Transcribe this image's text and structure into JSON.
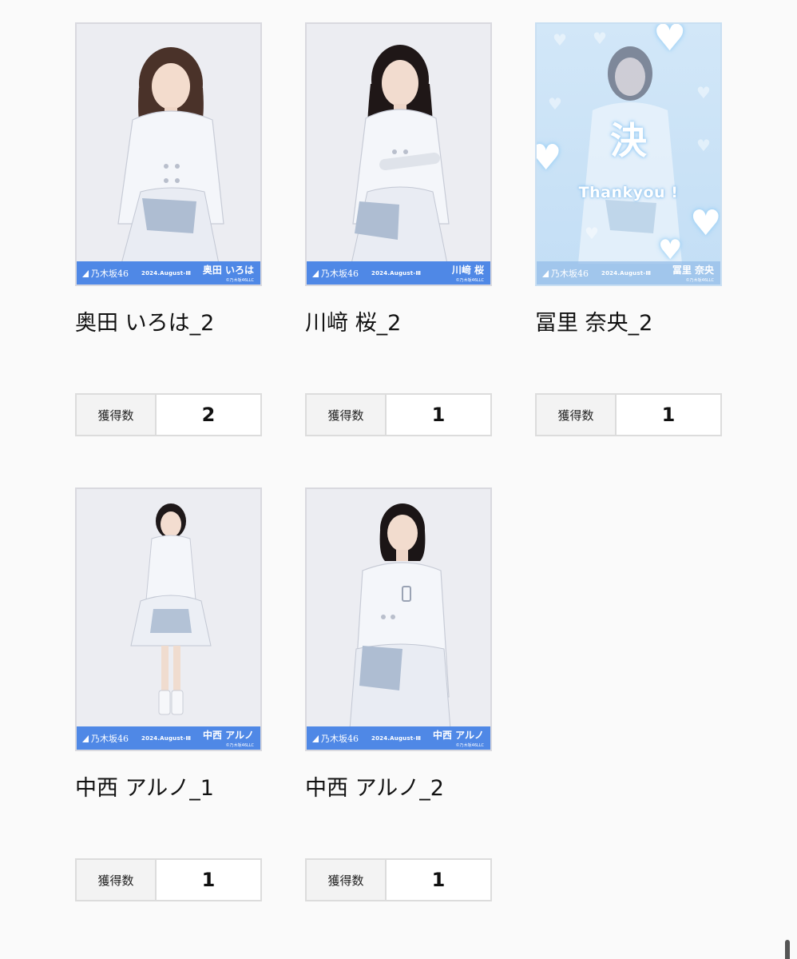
{
  "cards": [
    {
      "title": "奥田 いろは_2",
      "count_label": "獲得数",
      "count": "2",
      "photo": {
        "logo": "乃木坂46",
        "date": "2024.August-Ⅲ",
        "name": "奥田 いろは",
        "copyright": "©乃木坂46LLC"
      }
    },
    {
      "title": "川﨑 桜_2",
      "count_label": "獲得数",
      "count": "1",
      "photo": {
        "logo": "乃木坂46",
        "date": "2024.August-Ⅲ",
        "name": "川﨑 桜",
        "copyright": "©乃木坂46LLC"
      }
    },
    {
      "title": "冨里 奈央_2",
      "count_label": "獲得数",
      "count": "1",
      "photo": {
        "logo": "乃木坂46",
        "date": "2024.August-Ⅲ",
        "name": "冨里 奈央",
        "copyright": "©乃木坂46LLC",
        "overlay_kanji": "決",
        "overlay_text": "Thankyou !"
      }
    },
    {
      "title": "中西 アルノ_1",
      "count_label": "獲得数",
      "count": "1",
      "photo": {
        "logo": "乃木坂46",
        "date": "2024.August-Ⅲ",
        "name": "中西 アルノ",
        "copyright": "©乃木坂46LLC"
      }
    },
    {
      "title": "中西 アルノ_2",
      "count_label": "獲得数",
      "count": "1",
      "photo": {
        "logo": "乃木坂46",
        "date": "2024.August-Ⅲ",
        "name": "中西 アルノ",
        "copyright": "©乃木坂46LLC"
      }
    }
  ],
  "colors": {
    "band": "#4f88e6",
    "page_background": "#fafafa",
    "special_card_tint": "#c3def5"
  }
}
